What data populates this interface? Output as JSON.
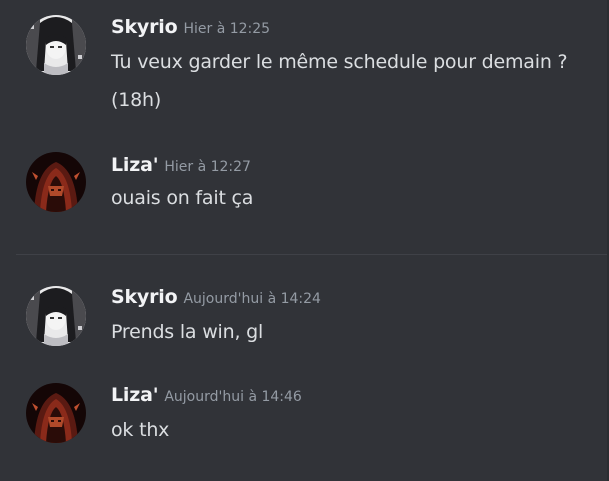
{
  "messages": [
    {
      "author": "Skyrio",
      "time": "Hier à 12:25",
      "lines": [
        "Tu veux garder le même schedule pour demain ?",
        "(18h)"
      ]
    },
    {
      "author": "Liza'",
      "time": "Hier à 12:27",
      "lines": [
        "ouais on fait ça"
      ]
    },
    {
      "author": "Skyrio",
      "time": "Aujourd'hui à 14:24",
      "lines": [
        "Prends la win, gl"
      ]
    },
    {
      "author": "Liza'",
      "time": "Aujourd'hui à 14:46",
      "lines": [
        "ok thx"
      ]
    }
  ],
  "colors": {
    "background": "#313338",
    "username": "#f2f3f5",
    "timestamp": "#949ba4",
    "text": "#dbdee1",
    "divider": "#3f4147"
  }
}
